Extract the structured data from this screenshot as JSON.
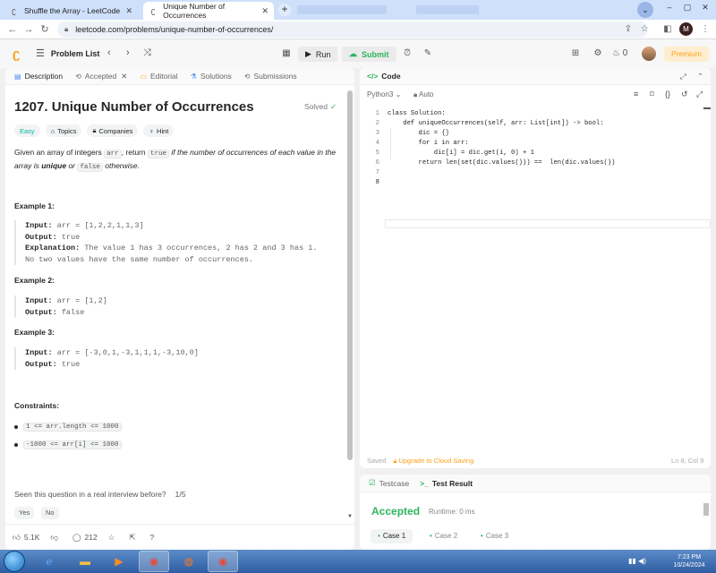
{
  "browser": {
    "tabs": [
      {
        "title": "Shuffle the Array - LeetCode",
        "active": false
      },
      {
        "title": "Unique Number of Occurrences",
        "active": true
      }
    ],
    "url": "leetcode.com/problems/unique-number-of-occurrences/",
    "profile_initial": "M"
  },
  "header": {
    "problem_list": "Problem List",
    "run": "Run",
    "submit": "Submit",
    "streak_count": "0",
    "premium": "Premium"
  },
  "left_tabs": [
    {
      "label": "Description",
      "icon": "document-icon"
    },
    {
      "label": "Accepted",
      "icon": "clock-icon"
    },
    {
      "label": "Editorial",
      "icon": "book-icon"
    },
    {
      "label": "Solutions",
      "icon": "flask-icon"
    },
    {
      "label": "Submissions",
      "icon": "history-icon"
    }
  ],
  "problem": {
    "title": "1207. Unique Number of Occurrences",
    "status": "Solved",
    "difficulty": "Easy",
    "chips": [
      "Topics",
      "Companies",
      "Hint"
    ],
    "desc_1": "Given an array of integers ",
    "desc_code1": "arr",
    "desc_2": ", return ",
    "desc_code2": "true",
    "desc_3": " if the number of occurrences of each value in the array is ",
    "desc_bold": "unique",
    "desc_4": " or ",
    "desc_code3": "false",
    "desc_5": " otherwise."
  },
  "examples": [
    {
      "heading": "Example 1:",
      "input": "arr = [1,2,2,1,1,3]",
      "output": "true",
      "explanation_1": "The value 1 has 3 occurrences, 2 has 2 and 3 has 1.",
      "explanation_2": "No two values have the same number of occurrences."
    },
    {
      "heading": "Example 2:",
      "input": "arr = [1,2]",
      "output": "false"
    },
    {
      "heading": "Example 3:",
      "input": "arr = [-3,0,1,-3,1,1,1,-3,10,0]",
      "output": "true"
    }
  ],
  "labels": {
    "input": "Input:",
    "output": "Output:",
    "explanation": "Explanation:"
  },
  "constraints": {
    "heading": "Constraints:",
    "items": [
      "1 <= arr.length <= 1000",
      "-1000 <= arr[i] <= 1000"
    ]
  },
  "interview": {
    "question": "Seen this question in a real interview before?",
    "count": "1/5",
    "yes": "Yes",
    "no": "No"
  },
  "footer": {
    "likes": "5.1K",
    "comments": "212"
  },
  "code_panel": {
    "title": "Code",
    "language": "Python3",
    "mode": "Auto",
    "lines": [
      "class Solution:",
      "    def uniqueOccurrences(self, arr: List[int]) -> bool:",
      "        dic = {}",
      "        for i in arr:",
      "            dic[i] = dic.get(i, 0) + 1",
      "        return len(set(dic.values())) ==  len(dic.values())",
      "",
      ""
    ],
    "saved": "Saved",
    "upgrade": "Upgrade to Cloud Saving",
    "cursor": "Ln 8, Col 9"
  },
  "result_panel": {
    "tabs": [
      "Testcase",
      "Test Result"
    ],
    "status": "Accepted",
    "runtime": "Runtime: 0 ms",
    "cases": [
      "Case 1",
      "Case 2",
      "Case 3"
    ]
  },
  "taskbar": {
    "time": "7:23 PM",
    "date": "10/24/2024"
  },
  "colors": {
    "accent_orange": "#ffa116",
    "accent_green": "#2db55d",
    "easy": "#00b8a3"
  }
}
